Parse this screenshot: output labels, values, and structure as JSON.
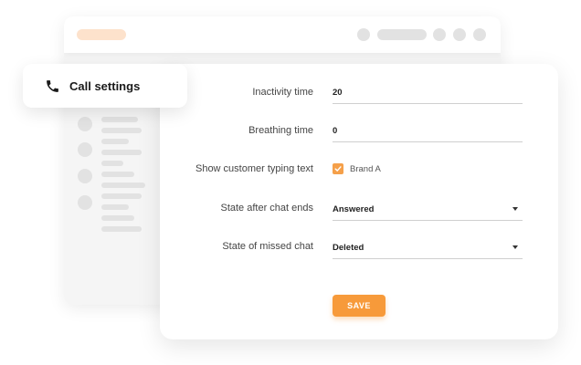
{
  "header": {
    "title": "Call settings",
    "icon": "phone-icon"
  },
  "form": {
    "inactivity_time": {
      "label": "Inactivity time",
      "value": "20"
    },
    "breathing_time": {
      "label": "Breathing time",
      "value": "0"
    },
    "typing_text": {
      "label": "Show customer typing text",
      "option_label": "Brand A",
      "checked": true
    },
    "state_after_chat": {
      "label": "State after chat ends",
      "value": "Answered"
    },
    "state_missed_chat": {
      "label": "State of missed chat",
      "value": "Deleted"
    },
    "save_label": "SAVE"
  },
  "colors": {
    "accent": "#f79a3a",
    "accent_light": "#fde2cc",
    "placeholder_grey": "#e2e2e2"
  }
}
